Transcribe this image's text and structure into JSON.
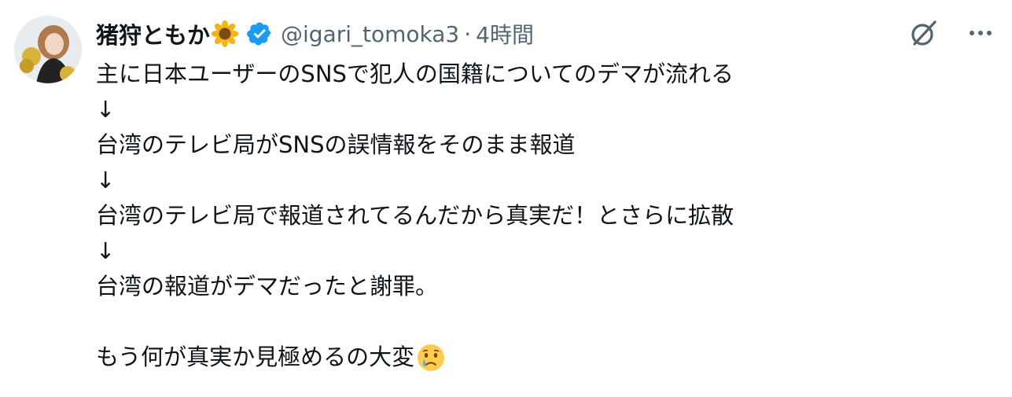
{
  "user": {
    "display_name": "猪狩ともか",
    "handle": "@igari_tomoka3",
    "separator": "·",
    "time": "4時間",
    "name_emoji": "sunflower-emoji",
    "verified_icon": "verified-badge-icon",
    "verified_color": "#1d9bf0"
  },
  "header_actions": {
    "grok_icon": "grok-icon",
    "more_icon": "more-options-icon"
  },
  "tweet": {
    "lines": [
      "主に日本ユーザーのSNSで犯人の国籍についてのデマが流れる",
      "↓",
      "台湾のテレビ局がSNSの誤情報をそのまま報道",
      "↓",
      "台湾のテレビ局で報道されてるんだから真実だ！とさらに拡散",
      "↓",
      "台湾の報道がデマだったと謝罪。",
      "",
      "もう何が真実か見極めるの大変"
    ],
    "end_emoji": "crying-face-emoji"
  },
  "colors": {
    "text": "#0f1419",
    "secondary": "#536471",
    "accent": "#1d9bf0"
  }
}
